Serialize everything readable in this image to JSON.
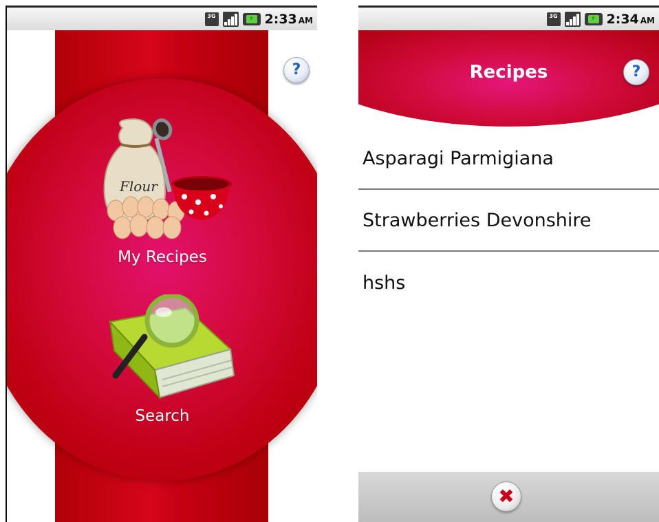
{
  "left_screen": {
    "status_bar": {
      "network": "3G",
      "time": "2:33",
      "ampm": "AM"
    },
    "help_button": {
      "label": "?"
    },
    "menu": [
      {
        "label": "My Recipes",
        "icon": "flour-eggs-bowl-icon"
      },
      {
        "label": "Search",
        "icon": "book-magnifier-icon"
      }
    ],
    "flour_text": "Flour"
  },
  "right_screen": {
    "status_bar": {
      "network": "3G",
      "time": "2:34",
      "ampm": "AM"
    },
    "title": "Recipes",
    "help_button": {
      "label": "?"
    },
    "recipes": [
      "Asparagi Parmigiana",
      "Strawberries Devonshire",
      "hshs"
    ],
    "close_button": {
      "label": "✖"
    }
  },
  "colors": {
    "primary_red": "#c40012",
    "magenta_glow": "#e3116d",
    "help_blue": "#1e63c8"
  }
}
